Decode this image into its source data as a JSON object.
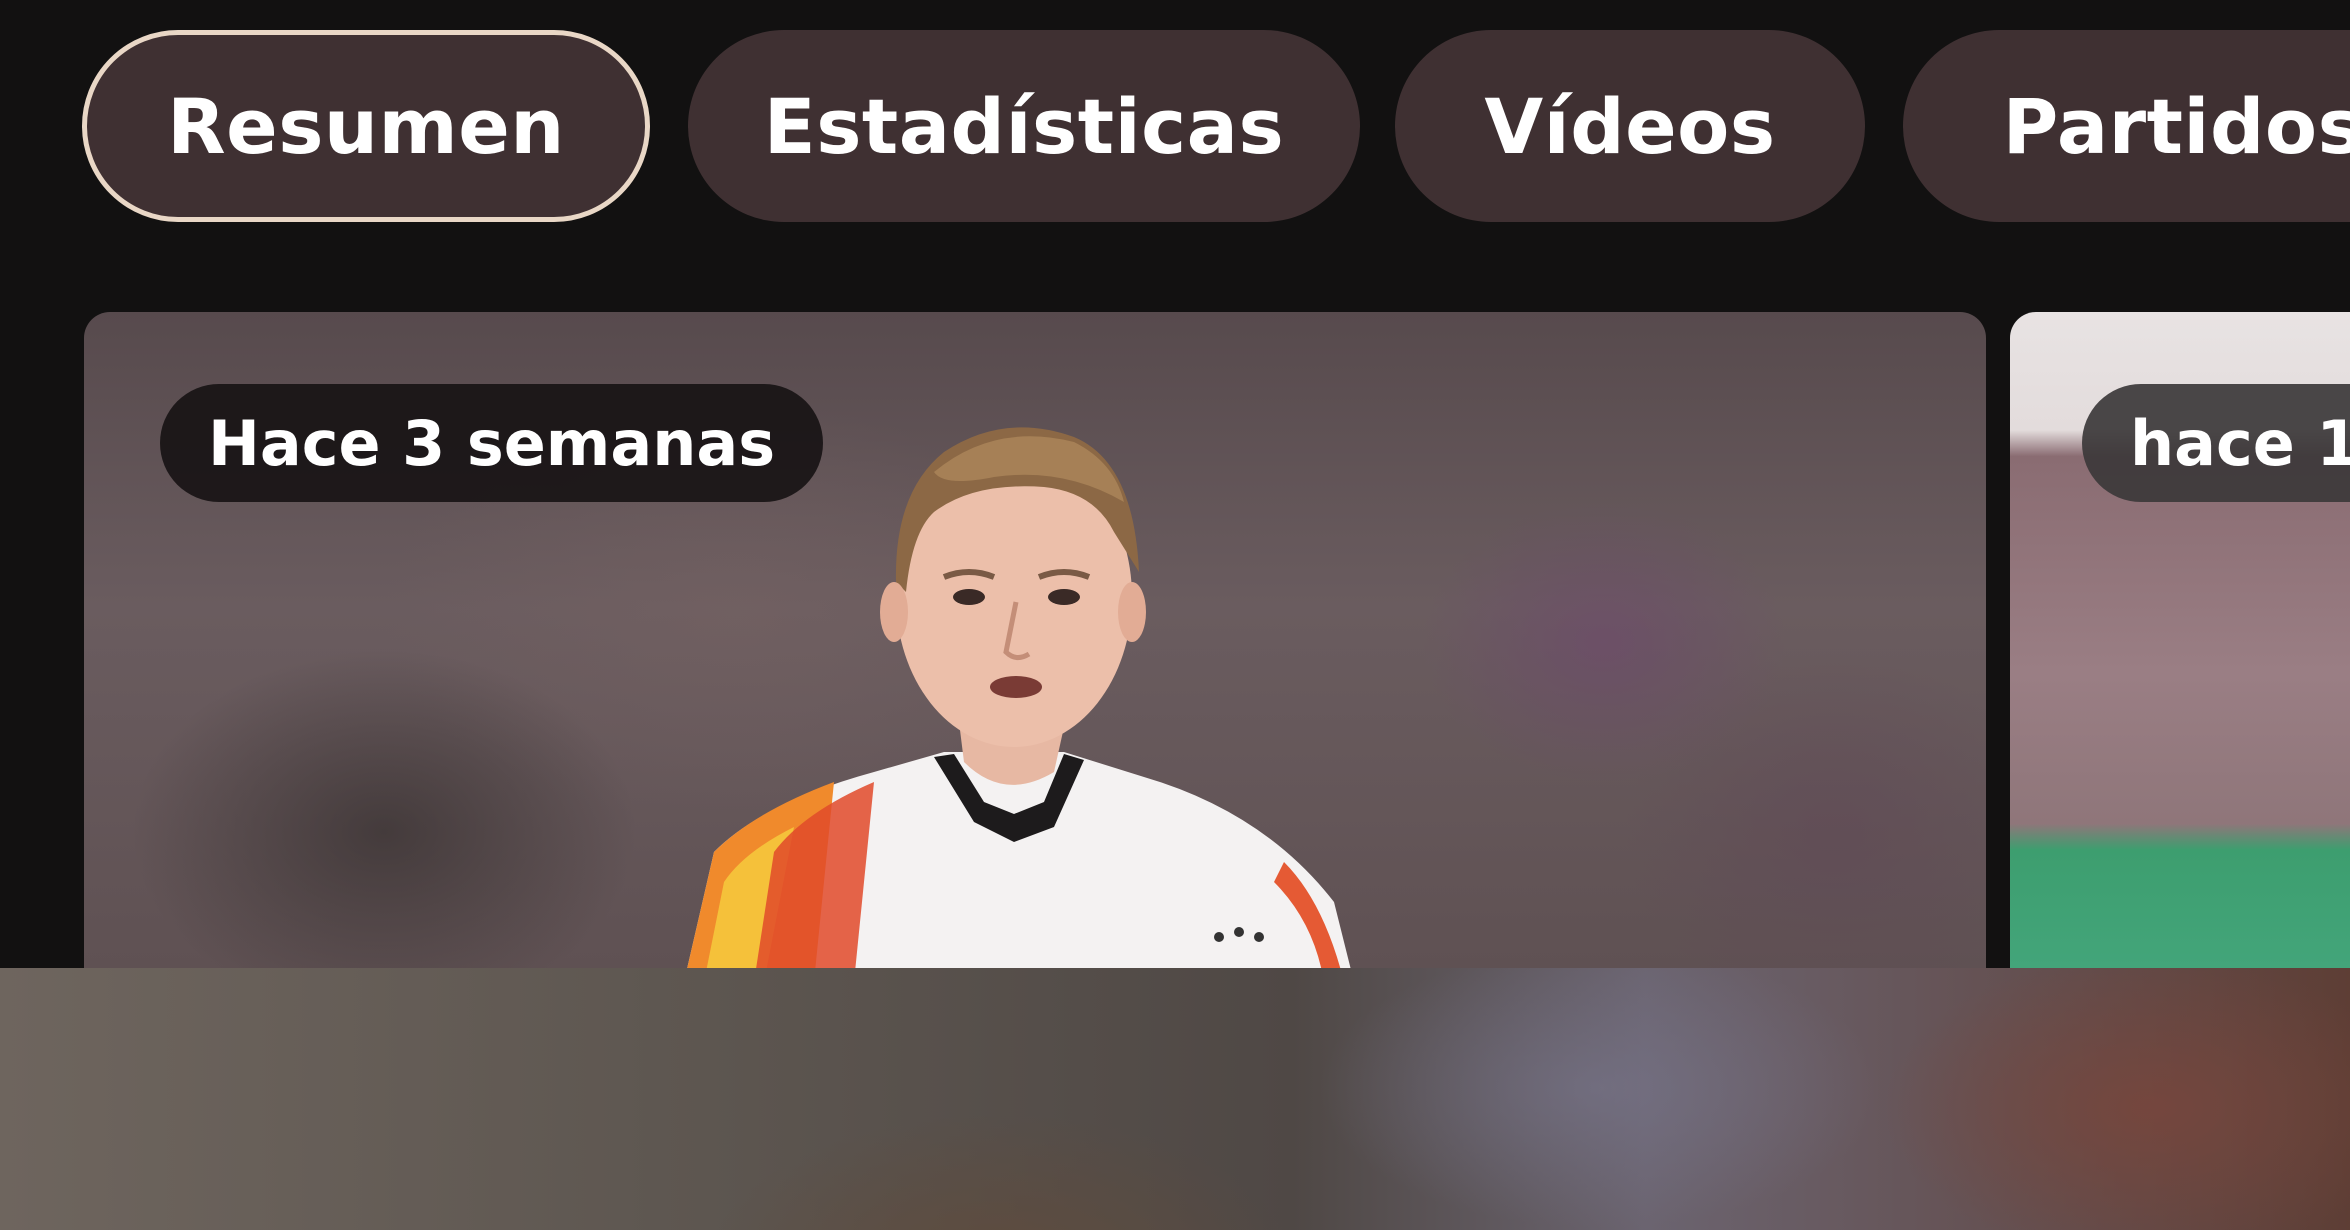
{
  "tabs": [
    {
      "label": "Resumen",
      "active": true
    },
    {
      "label": "Estadísticas",
      "active": false
    },
    {
      "label": "Vídeos",
      "active": false
    },
    {
      "label": "Partidos",
      "active": false
    }
  ],
  "cards": [
    {
      "time_label": "Hace 3 semanas",
      "image": "football-player-photo"
    },
    {
      "time_label": "hace 1",
      "image": "stadium-crowd-photo"
    }
  ],
  "bottom_media": {
    "image": "blurred-photo"
  },
  "colors": {
    "background": "#121111",
    "chip": "#3f3032",
    "chip_active_border": "#e9d7c6",
    "text": "#ffffff"
  }
}
